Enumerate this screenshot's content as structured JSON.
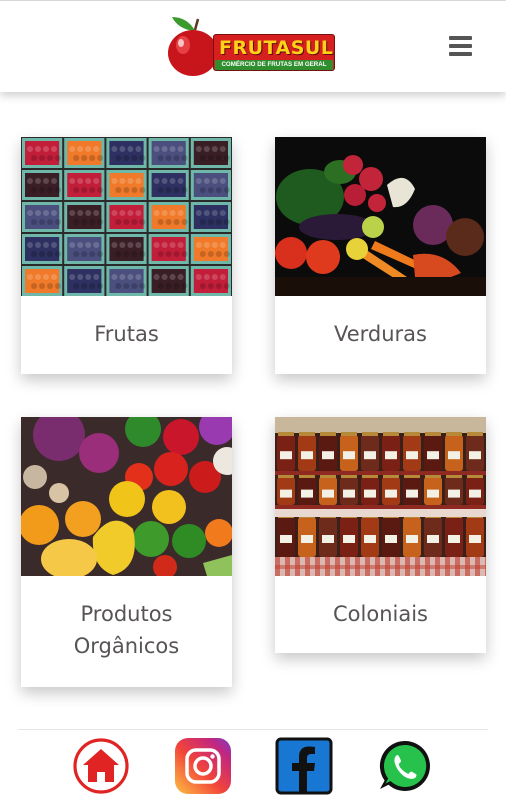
{
  "header": {
    "logo": {
      "title": "FRUTASUL",
      "subtitle": "COMÉRCIO DE FRUTAS EM GERAL",
      "icon": "apple-icon"
    },
    "menu_icon": "hamburger-menu-icon"
  },
  "categories": [
    {
      "label": "Frutas",
      "image": "berries-baskets-photo"
    },
    {
      "label": "Verduras",
      "image": "vegetables-photo"
    },
    {
      "label_line1": "Produtos",
      "label_line2": "Orgânicos",
      "image": "organic-produce-photo"
    },
    {
      "label": "Coloniais",
      "image": "preserves-jars-photo"
    }
  ],
  "footer": {
    "icons": [
      "home-icon",
      "instagram-icon",
      "facebook-icon",
      "whatsapp-icon"
    ]
  },
  "colors": {
    "brand_red": "#d61f1f",
    "brand_yellow": "#ffd21a",
    "brand_green": "#2f8f2f",
    "label_text": "#585454"
  }
}
